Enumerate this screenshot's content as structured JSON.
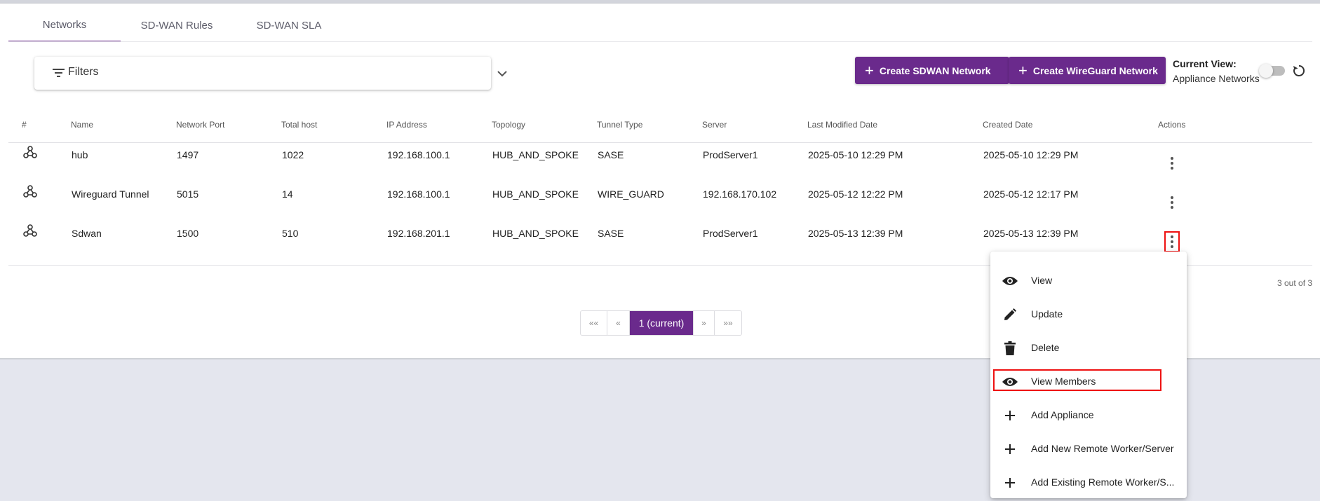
{
  "tabs": [
    {
      "label": "Networks"
    },
    {
      "label": "SD-WAN Rules"
    },
    {
      "label": "SD-WAN SLA"
    }
  ],
  "filters": {
    "label": "Filters"
  },
  "buttons": {
    "create_sdwan": "Create SDWAN Network",
    "create_wireguard": "Create WireGuard Network"
  },
  "current_view": {
    "title": "Current View:",
    "value": "Appliance Networks",
    "toggle_on": false
  },
  "table": {
    "headers": [
      "#",
      "Name",
      "Network Port",
      "Total host",
      "IP Address",
      "Topology",
      "Tunnel Type",
      "Server",
      "Last Modified Date",
      "Created Date",
      "Actions"
    ],
    "rows": [
      {
        "name": "hub",
        "port": "1497",
        "hosts": "1022",
        "ip": "192.168.100.1",
        "topology": "HUB_AND_SPOKE",
        "tunnel": "SASE",
        "server": "ProdServer1",
        "modified": "2025-05-10 12:29 PM",
        "created": "2025-05-10 12:29 PM"
      },
      {
        "name": "Wireguard Tunnel",
        "port": "5015",
        "hosts": "14",
        "ip": "192.168.100.1",
        "topology": "HUB_AND_SPOKE",
        "tunnel": "WIRE_GUARD",
        "server": "192.168.170.102",
        "modified": "2025-05-12 12:22 PM",
        "created": "2025-05-12 12:17 PM"
      },
      {
        "name": "Sdwan",
        "port": "1500",
        "hosts": "510",
        "ip": "192.168.201.1",
        "topology": "HUB_AND_SPOKE",
        "tunnel": "SASE",
        "server": "ProdServer1",
        "modified": "2025-05-13 12:39 PM",
        "created": "2025-05-13 12:39 PM"
      }
    ]
  },
  "count": "3 out of 3",
  "pagination": {
    "first": "«« ",
    "prev": "«",
    "current": "1 (current)",
    "next": "»",
    "last": "»»"
  },
  "menu": {
    "items": [
      {
        "label": "View",
        "icon": "eye-icon"
      },
      {
        "label": "Update",
        "icon": "pencil-icon"
      },
      {
        "label": "Delete",
        "icon": "trash-icon"
      },
      {
        "label": "View Members",
        "icon": "eye-icon"
      },
      {
        "label": "Add Appliance",
        "icon": "plus-icon"
      },
      {
        "label": "Add New Remote Worker/Server",
        "icon": "plus-icon"
      },
      {
        "label": "Add Existing Remote Worker/S...",
        "icon": "plus-icon"
      }
    ]
  },
  "colors": {
    "accent": "#6a2a8c",
    "highlight": "#e11111"
  }
}
